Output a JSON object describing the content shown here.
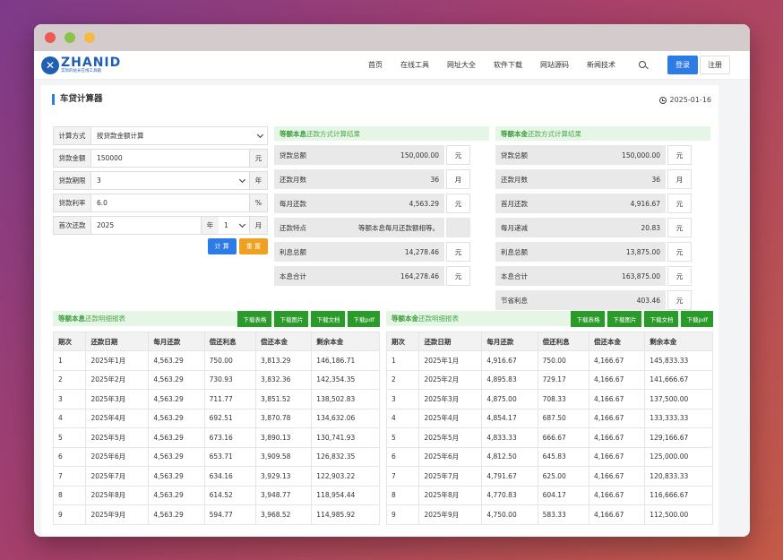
{
  "brand": {
    "name": "ZHANID",
    "slogan": "实际的站长在线工具箱"
  },
  "nav": {
    "items": [
      "首页",
      "在线工具",
      "网址大全",
      "软件下载",
      "网站源码",
      "新闻技术"
    ]
  },
  "auth": {
    "login": "登录",
    "register": "注册"
  },
  "page": {
    "title": "车贷计算器",
    "date": "2025-01-16"
  },
  "form": {
    "method_label": "计算方式",
    "method_value": "按贷款金额计算",
    "amount_label": "贷款金额",
    "amount_value": "150000",
    "amount_unit": "元",
    "term_label": "贷款期限",
    "term_value": "3",
    "term_unit": "年",
    "rate_label": "贷款利率",
    "rate_value": "6.0",
    "rate_unit": "%",
    "first_label": "首次还款",
    "first_year": "2025",
    "first_year_unit": "年",
    "first_month": "1",
    "first_month_unit": "月",
    "calc": "计 算",
    "reset": "重 置"
  },
  "equal_payment": {
    "head_bold": "等额本息",
    "head_rest": "还款方式计算结果",
    "rows": [
      {
        "label": "贷款总额",
        "value": "150,000.00",
        "unit": "元"
      },
      {
        "label": "还款月数",
        "value": "36",
        "unit": "月"
      },
      {
        "label": "每月还款",
        "value": "4,563.29",
        "unit": "元"
      },
      {
        "label": "还款特点",
        "value": "等额本息每月还款额相等。",
        "unit": ""
      },
      {
        "label": "利息总额",
        "value": "14,278.46",
        "unit": "元"
      },
      {
        "label": "本息合计",
        "value": "164,278.46",
        "unit": "元"
      }
    ]
  },
  "equal_principal": {
    "head_bold": "等额本金",
    "head_rest": "还款方式计算结果",
    "rows": [
      {
        "label": "贷款总额",
        "value": "150,000.00",
        "unit": "元"
      },
      {
        "label": "还款月数",
        "value": "36",
        "unit": "月"
      },
      {
        "label": "首月还款",
        "value": "4,916.67",
        "unit": "元"
      },
      {
        "label": "每月递减",
        "value": "20.83",
        "unit": "元"
      },
      {
        "label": "利息总额",
        "value": "13,875.00",
        "unit": "元"
      },
      {
        "label": "本息合计",
        "value": "163,875.00",
        "unit": "元"
      },
      {
        "label": "节省利息",
        "value": "403.46",
        "unit": "元"
      }
    ]
  },
  "table_left": {
    "title_bold": "等额本息",
    "title_rest": "还款明细报表",
    "buttons": [
      "下载表格",
      "下载图片",
      "下载文档",
      "下载pdf"
    ],
    "headers": [
      "期次",
      "还款日期",
      "每月还款",
      "偿还利息",
      "偿还本金",
      "剩余本金"
    ],
    "rows": [
      [
        "1",
        "2025年1月",
        "4,563.29",
        "750.00",
        "3,813.29",
        "146,186.71"
      ],
      [
        "2",
        "2025年2月",
        "4,563.29",
        "730.93",
        "3,832.36",
        "142,354.35"
      ],
      [
        "3",
        "2025年3月",
        "4,563.29",
        "711.77",
        "3,851.52",
        "138,502.83"
      ],
      [
        "4",
        "2025年4月",
        "4,563.29",
        "692.51",
        "3,870.78",
        "134,632.06"
      ],
      [
        "5",
        "2025年5月",
        "4,563.29",
        "673.16",
        "3,890.13",
        "130,741.93"
      ],
      [
        "6",
        "2025年6月",
        "4,563.29",
        "653.71",
        "3,909.58",
        "126,832.35"
      ],
      [
        "7",
        "2025年7月",
        "4,563.29",
        "634.16",
        "3,929.13",
        "122,903.22"
      ],
      [
        "8",
        "2025年8月",
        "4,563.29",
        "614.52",
        "3,948.77",
        "118,954.44"
      ],
      [
        "9",
        "2025年9月",
        "4,563.29",
        "594.77",
        "3,968.52",
        "114,985.92"
      ]
    ]
  },
  "table_right": {
    "title_bold": "等额本金",
    "title_rest": "还款明细报表",
    "buttons": [
      "下载表格",
      "下载图片",
      "下载文档",
      "下载pdf"
    ],
    "headers": [
      "期次",
      "还款日期",
      "每月还款",
      "偿还利息",
      "偿还本金",
      "剩余本金"
    ],
    "rows": [
      [
        "1",
        "2025年1月",
        "4,916.67",
        "750.00",
        "4,166.67",
        "145,833.33"
      ],
      [
        "2",
        "2025年2月",
        "4,895.83",
        "729.17",
        "4,166.67",
        "141,666.67"
      ],
      [
        "3",
        "2025年3月",
        "4,875.00",
        "708.33",
        "4,166.67",
        "137,500.00"
      ],
      [
        "4",
        "2025年4月",
        "4,854.17",
        "687.50",
        "4,166.67",
        "133,333.33"
      ],
      [
        "5",
        "2025年5月",
        "4,833.33",
        "666.67",
        "4,166.67",
        "129,166.67"
      ],
      [
        "6",
        "2025年6月",
        "4,812.50",
        "645.83",
        "4,166.67",
        "125,000.00"
      ],
      [
        "7",
        "2025年7月",
        "4,791.67",
        "625.00",
        "4,166.67",
        "120,833.33"
      ],
      [
        "8",
        "2025年8月",
        "4,770.83",
        "604.17",
        "4,166.67",
        "116,666.67"
      ],
      [
        "9",
        "2025年9月",
        "4,750.00",
        "583.33",
        "4,166.67",
        "112,500.00"
      ]
    ]
  }
}
